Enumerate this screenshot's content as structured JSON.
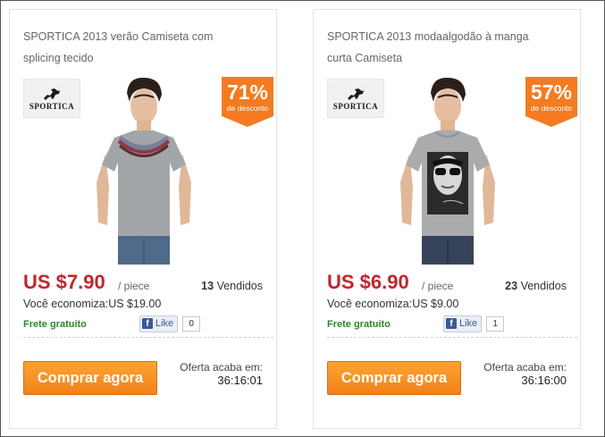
{
  "products": [
    {
      "title": "SPORTICA 2013 verão Camiseta com splicing tecido",
      "brand": "SPORTICA",
      "brand_tagline": "",
      "discount_pct": "71%",
      "discount_label": "de desconto",
      "price": "US $7.90",
      "unit": "/ piece",
      "sold_count": "13",
      "sold_label": "Vendidos",
      "save_label": "Você economiza:",
      "save_amount": "US $19.00",
      "shipping": "Frete gratuito",
      "like_label": "Like",
      "like_count": "0",
      "buy_label": "Comprar agora",
      "ends_label": "Oferta acaba em:",
      "countdown": "36:16:01"
    },
    {
      "title": "SPORTICA 2013 modaalgodão à manga curta Camiseta",
      "brand": "SPORTICA",
      "brand_tagline": "",
      "discount_pct": "57%",
      "discount_label": "de desconto",
      "price": "US $6.90",
      "unit": "/ piece",
      "sold_count": "23",
      "sold_label": "Vendidos",
      "save_label": "Você economiza:",
      "save_amount": "US $9.00",
      "shipping": "Frete gratuito",
      "like_label": "Like",
      "like_count": "1",
      "buy_label": "Comprar agora",
      "ends_label": "Oferta acaba em:",
      "countdown": "36:16:00"
    }
  ],
  "colors": {
    "price": "#c0262d",
    "badge": "#f47b20",
    "button": "#f2811c",
    "shipping": "#2a8a2a",
    "facebook": "#3b5998"
  }
}
